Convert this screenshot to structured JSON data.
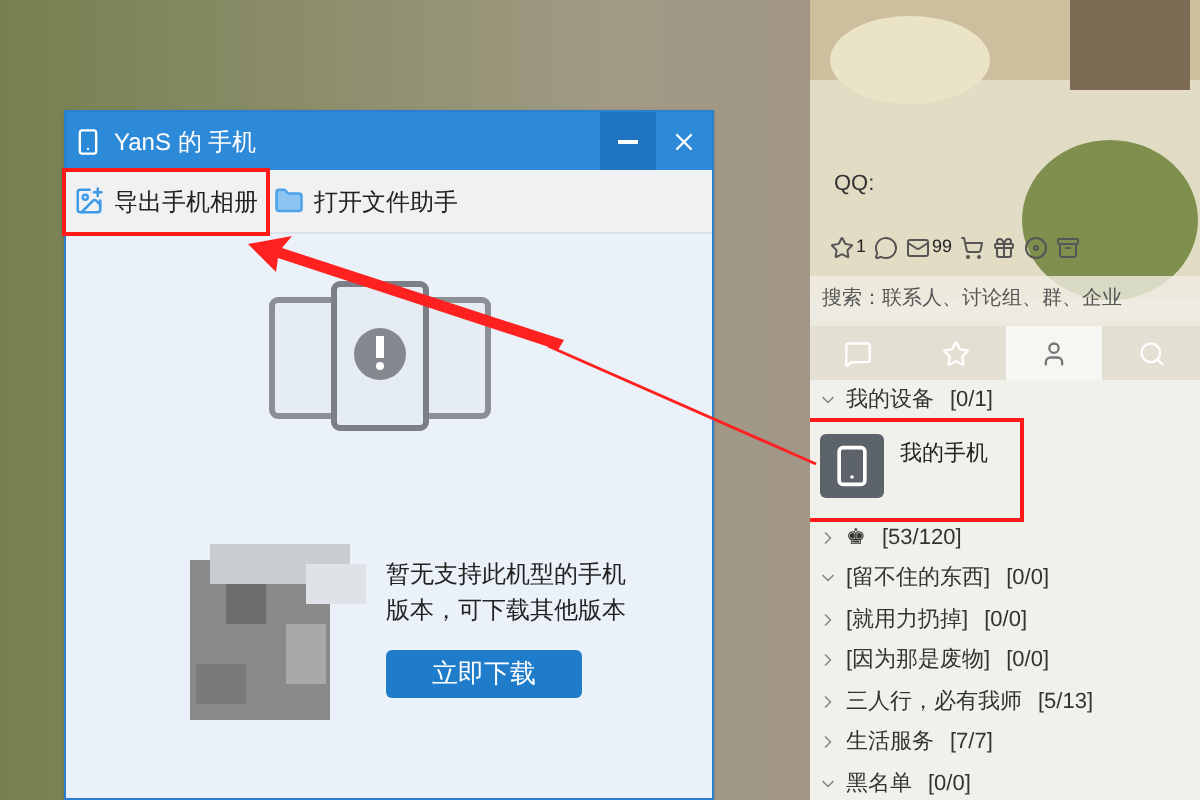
{
  "phone_window": {
    "title": "YanS 的 手机",
    "toolbar": [
      {
        "kind": "export",
        "label": "导出手机相册",
        "highlighted": true
      },
      {
        "kind": "folder",
        "label": "打开文件助手",
        "highlighted": false
      }
    ],
    "message": [
      "暂无支持此机型的手机",
      "版本，可下载其他版本"
    ],
    "download_button": "立即下载"
  },
  "qq_panel": {
    "account_label": "QQ:",
    "notifications": [
      {
        "kind": "star",
        "count": "1"
      },
      {
        "kind": "chat"
      },
      {
        "kind": "mail",
        "count": "99"
      },
      {
        "kind": "cart"
      },
      {
        "kind": "gift"
      },
      {
        "kind": "disc"
      },
      {
        "kind": "box"
      }
    ],
    "search": {
      "placeholder": "搜索：联系人、讨论组、群、企业"
    },
    "tabs": [
      {
        "kind": "chat",
        "selected": false
      },
      {
        "kind": "star",
        "selected": false
      },
      {
        "kind": "contact",
        "selected": true
      },
      {
        "kind": "search",
        "selected": false
      }
    ],
    "groups": [
      {
        "name": "我的设备",
        "count": "[0/1]",
        "expanded": true,
        "children": [
          {
            "name": "我的手机",
            "highlighted": true
          }
        ]
      },
      {
        "name": "♚",
        "count": "[53/120]",
        "expanded": false
      },
      {
        "name": "[留不住的东西]",
        "count": "[0/0]",
        "expanded": true
      },
      {
        "name": "[就用力扔掉]",
        "count": "[0/0]",
        "expanded": false
      },
      {
        "name": "[因为那是废物]",
        "count": "[0/0]",
        "expanded": false
      },
      {
        "name": "三人行，必有我师",
        "count": "[5/13]",
        "expanded": false
      },
      {
        "name": "生活服务",
        "count": "[7/7]",
        "expanded": false
      },
      {
        "name": "黑名单",
        "count": "[0/0]",
        "expanded": true
      }
    ]
  }
}
